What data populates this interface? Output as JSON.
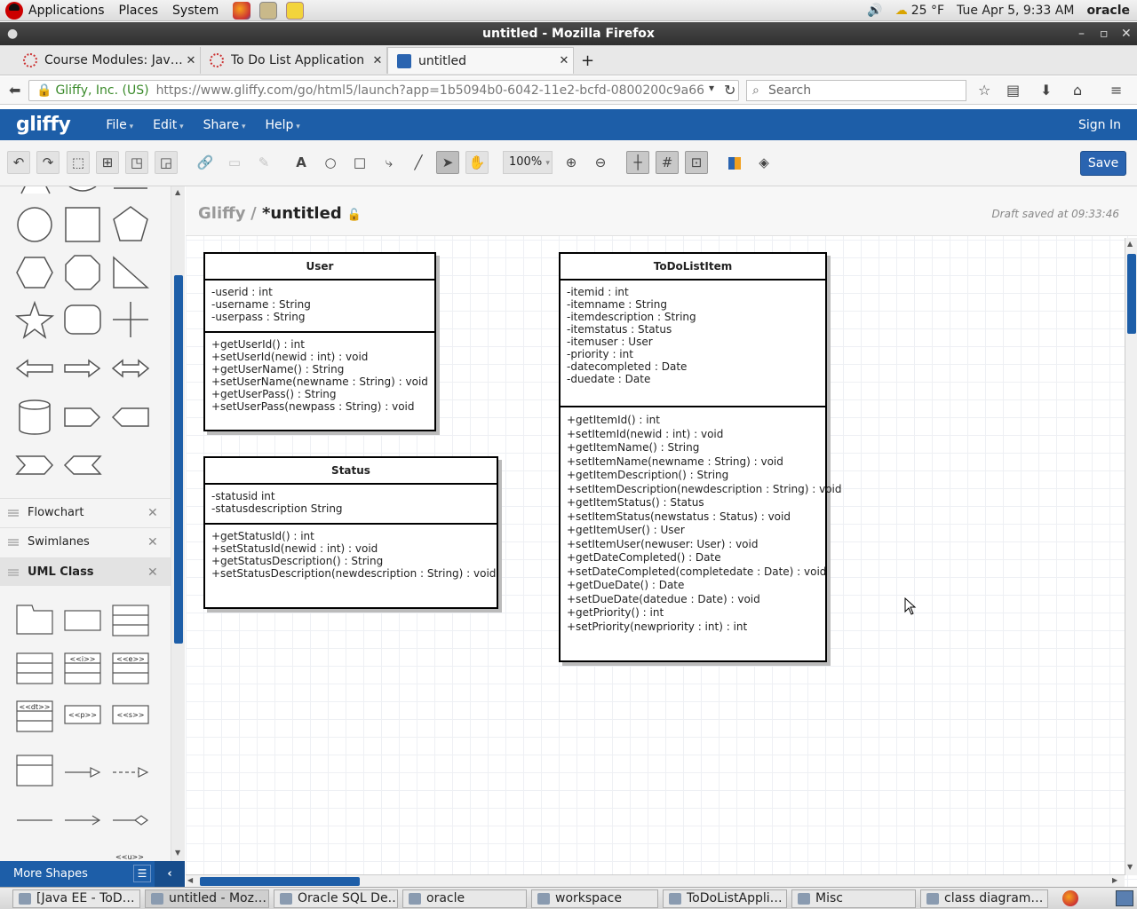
{
  "system_bar": {
    "menus": [
      "Applications",
      "Places",
      "System"
    ],
    "temperature": "25 °F",
    "datetime": "Tue Apr  5,  9:33 AM",
    "user": "oracle"
  },
  "window": {
    "title": "untitled - Mozilla Firefox"
  },
  "tabs": [
    {
      "label": "Course Modules: Jav…",
      "active": false
    },
    {
      "label": "To Do List Application",
      "active": false
    },
    {
      "label": "untitled",
      "active": true
    }
  ],
  "urlbar": {
    "org": "Gliffy, Inc. (US)",
    "url": "https://www.gliffy.com/go/html5/launch?app=1b5094b0-6042-11e2-bcfd-0800200c9a66",
    "search_placeholder": "Search"
  },
  "app": {
    "logo": "gliffy",
    "menus": [
      "File",
      "Edit",
      "Share",
      "Help"
    ],
    "signin": "Sign In",
    "save": "Save",
    "zoom": "100%"
  },
  "doc": {
    "crumb": "Gliffy",
    "name": "*untitled",
    "saved_status": "Draft saved at 09:33:46"
  },
  "libraries": [
    {
      "name": "Flowchart"
    },
    {
      "name": "Swimlanes"
    },
    {
      "name": "UML Class"
    }
  ],
  "more_shapes": "More Shapes",
  "uml_classes": [
    {
      "name": "User",
      "attributes": [
        "-userid : int",
        "-username : String",
        "-userpass : String"
      ],
      "methods": [
        "+getUserId() : int",
        "+setUserId(newid : int) : void",
        "+getUserName() : String",
        "+setUserName(newname : String) : void",
        "+getUserPass() : String",
        "+setUserPass(newpass : String) : void"
      ]
    },
    {
      "name": "Status",
      "attributes": [
        "-statusid int",
        "-statusdescription String"
      ],
      "methods": [
        "+getStatusId() : int",
        "+setStatusId(newid : int) : void",
        "+getStatusDescription() : String",
        "+setStatusDescription(newdescription : String) : void"
      ]
    },
    {
      "name": "ToDoListItem",
      "attributes": [
        "-itemid : int",
        "-itemname : String",
        "-itemdescription : String",
        "-itemstatus : Status",
        "-itemuser : User",
        "-priority : int",
        "-datecompleted : Date",
        "-duedate : Date"
      ],
      "methods": [
        "+getItemId() : int",
        "+setItemId(newid : int) : void",
        "+getItemName() : String",
        "+setItemName(newname : String) : void",
        "+getItemDescription() : String",
        "+setItemDescription(newdescription : String) : void",
        "+getItemStatus() : Status",
        "+setItemStatus(newstatus : Status) : void",
        "+getItemUser() : User",
        "+setItemUser(newuser: User) : void",
        "+getDateCompleted() : Date",
        "+setDateCompleted(completedate : Date) : void",
        "+getDueDate() : Date",
        "+setDueDate(datedue : Date) : void",
        "+getPriority() : int",
        "+setPriority(newpriority : int) : int"
      ]
    }
  ],
  "taskbar": [
    {
      "label": "[Java EE - ToD…"
    },
    {
      "label": "untitled - Moz…"
    },
    {
      "label": "Oracle SQL De…"
    },
    {
      "label": "oracle"
    },
    {
      "label": "workspace"
    },
    {
      "label": "ToDoListAppli…"
    },
    {
      "label": "Misc"
    },
    {
      "label": "class diagram…"
    }
  ],
  "colors": {
    "brand": "#1d5ea8",
    "save": "#2a64b0"
  }
}
